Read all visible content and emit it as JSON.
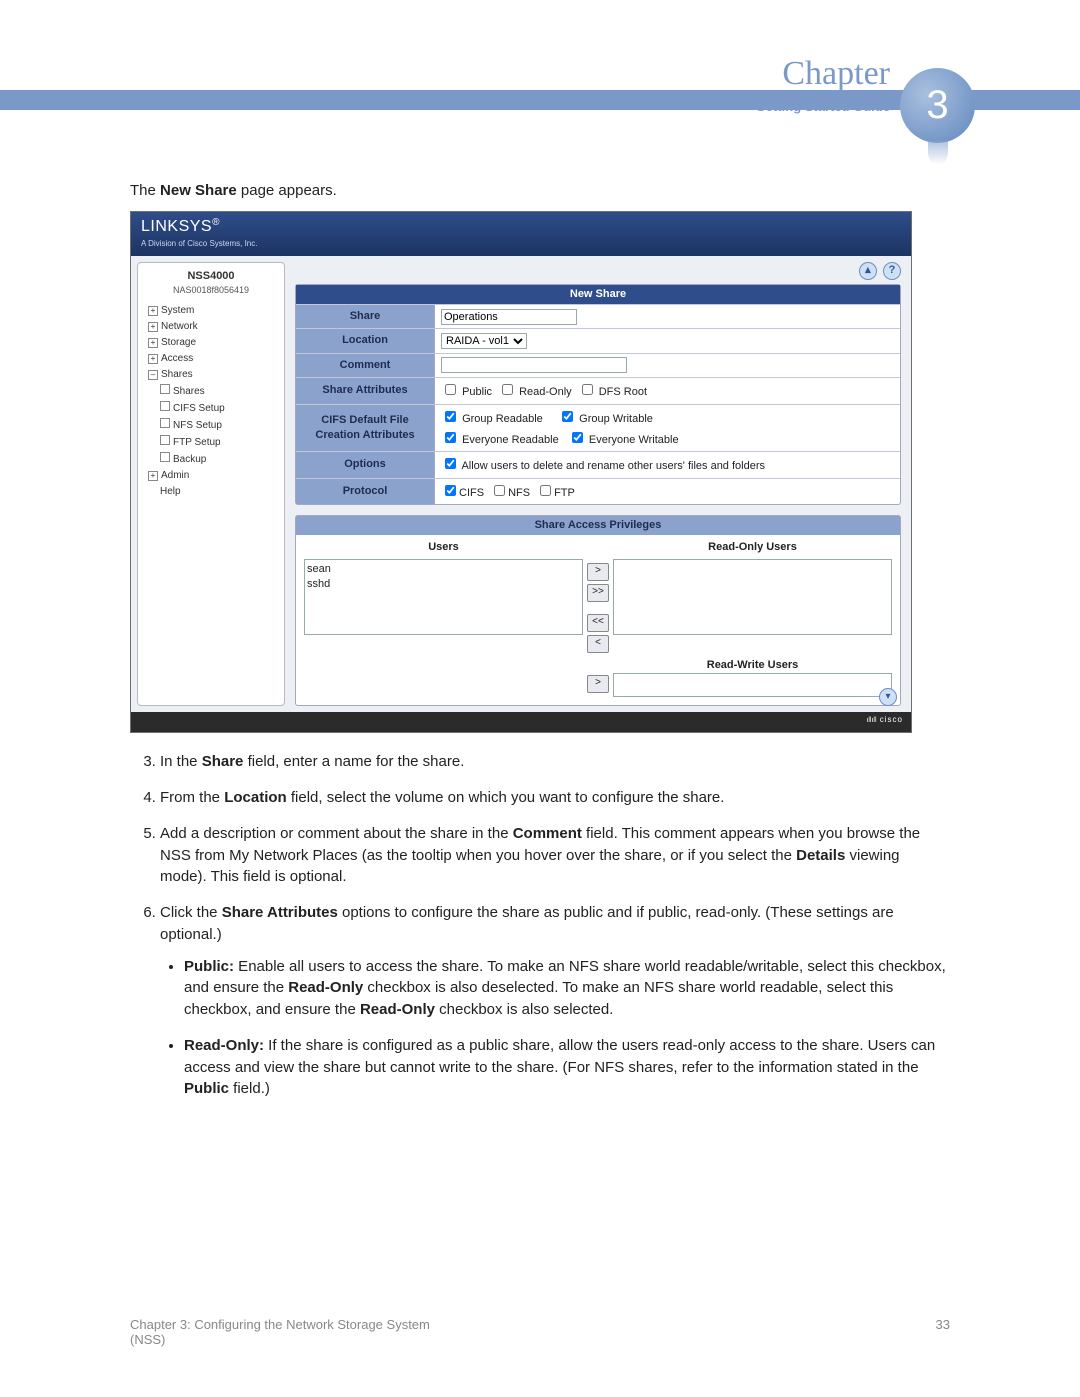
{
  "header": {
    "chapter_label": "Chapter",
    "guide_label": "Getting Started Guide",
    "chapter_number": "3"
  },
  "intro": {
    "pre": "The ",
    "bold": "New Share",
    "post": " page appears."
  },
  "screenshot": {
    "brand": "LINKSYS",
    "brand_tag": "A Division of Cisco Systems, Inc.",
    "device_name": "NSS4000",
    "device_sub": "NAS0018f8056419",
    "nav": {
      "system": "System",
      "network": "Network",
      "storage": "Storage",
      "access": "Access",
      "shares": "Shares",
      "shares_sub": "Shares",
      "cifs": "CIFS Setup",
      "nfs": "NFS Setup",
      "ftp": "FTP Setup",
      "backup": "Backup",
      "admin": "Admin",
      "help": "Help"
    },
    "form": {
      "title": "New Share",
      "labels": {
        "share": "Share",
        "location": "Location",
        "comment": "Comment",
        "share_attributes": "Share Attributes",
        "cifs_default": "CIFS Default File Creation Attributes",
        "options": "Options",
        "protocol": "Protocol"
      },
      "values": {
        "share": "Operations",
        "location_option": "RAIDA - vol1",
        "attr_public": "Public",
        "attr_readonly": "Read-Only",
        "attr_dfs": "DFS Root",
        "cifs_gr": "Group Readable",
        "cifs_gw": "Group Writable",
        "cifs_er": "Everyone Readable",
        "cifs_ew": "Everyone Writable",
        "option_allow": "Allow users to delete and rename other users' files and folders",
        "proto_cifs": "CIFS",
        "proto_nfs": "NFS",
        "proto_ftp": "FTP"
      }
    },
    "privileges": {
      "header": "Share Access Privileges",
      "users_header": "Users",
      "readonly_header": "Read-Only Users",
      "readwrite_header": "Read-Write Users",
      "users": {
        "u1": "sean",
        "u2": "sshd"
      },
      "buttons": {
        "right": ">",
        "right_all": ">>",
        "left_all": "<<",
        "left": "<"
      }
    },
    "footer_brand": "cisco"
  },
  "steps": {
    "s3": {
      "pre": "In the ",
      "b1": "Share",
      "post": " field, enter a name for the share."
    },
    "s4": {
      "pre": "From the ",
      "b1": "Location",
      "post": " field, select the volume on which you want to configure the share."
    },
    "s5": {
      "pre": "Add a description or comment about the share in the ",
      "b1": "Comment",
      "mid": " field. This comment appears when you browse the NSS from My Network Places (as the tooltip when you hover over the share, or if you select the ",
      "b2": "Details",
      "post": " viewing mode). This field is optional."
    },
    "s6": {
      "pre": "Click the ",
      "b1": "Share Attributes",
      "post": " options to configure the share as public and if public, read-only. (These settings are optional.)"
    },
    "bullet_public": {
      "b1": "Public:",
      "text": " Enable all users to access the share. To make an NFS share world readable/writable, select this checkbox, and ensure the ",
      "b2": "Read-Only",
      "text2": " checkbox is also deselected. To make an NFS share world readable, select this checkbox, and ensure the ",
      "b3": "Read-Only",
      "text3": " checkbox is also selected."
    },
    "bullet_readonly": {
      "b1": "Read-Only:",
      "text": " If the share is configured as a public share, allow the users read-only access to the share. Users can access and view the share but cannot write to the share. (For NFS shares, refer to the information stated in the ",
      "b2": "Public",
      "text2": " field.)"
    }
  },
  "footer": {
    "left_line1": "Chapter 3: Configuring the Network Storage System",
    "left_line2": "(NSS)",
    "page_number": "33"
  }
}
